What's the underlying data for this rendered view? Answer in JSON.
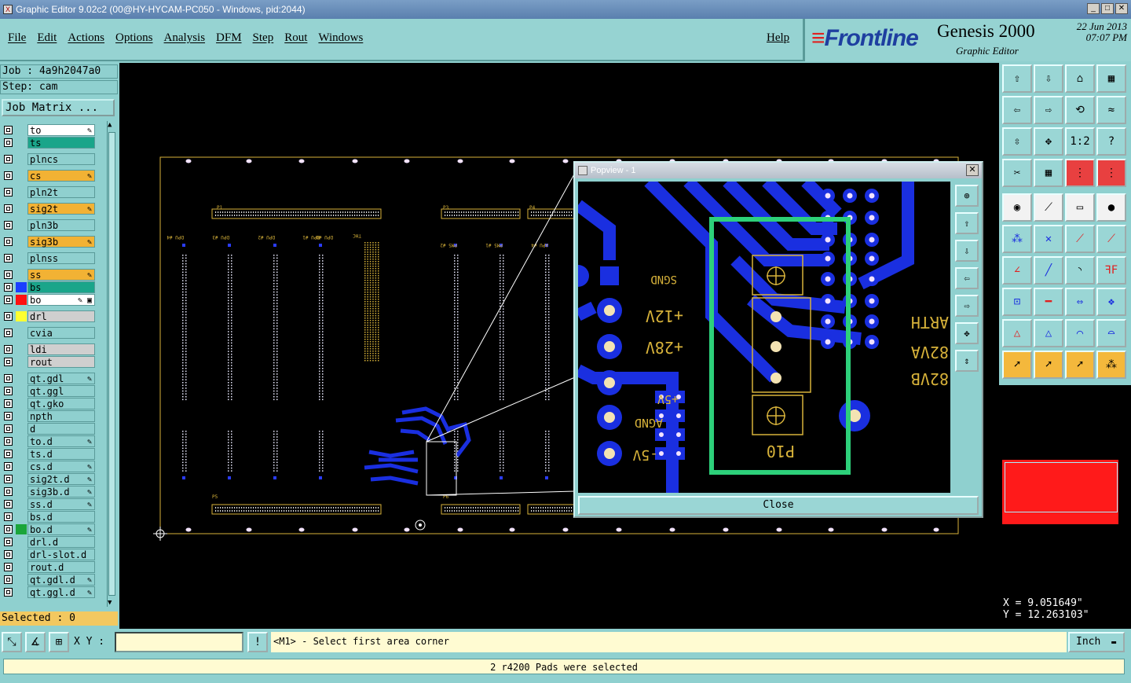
{
  "window": {
    "title": "Graphic Editor 9.02c2 (00@HY-HYCAM-PC050 - Windows, pid:2044)",
    "icon": "app-icon"
  },
  "menu": {
    "items": [
      "File",
      "Edit",
      "Actions",
      "Options",
      "Analysis",
      "DFM",
      "Step",
      "Rout",
      "Windows"
    ],
    "help": "Help"
  },
  "brand": {
    "logo": "Frontline",
    "product": "Genesis 2000",
    "subtitle": "Graphic Editor",
    "date": "22 Jun 2013",
    "time": "07:07 PM"
  },
  "left": {
    "job": "Job : 4a9h2047a0",
    "step": "Step: cam",
    "job_matrix": "Job Matrix ...",
    "layers": [
      {
        "name": "to",
        "color": "#ffffff",
        "swatch": "#8fd0cf",
        "mark": "✎"
      },
      {
        "name": "ts",
        "color": "#1aa58a",
        "swatch": "#8fd0cf",
        "mark": ""
      },
      {
        "name": "plncs",
        "color": "#8fd0cf",
        "swatch": "#8fd0cf",
        "mark": ""
      },
      {
        "name": "cs",
        "color": "#f2b234",
        "swatch": "#8fd0cf",
        "mark": "✎"
      },
      {
        "name": "pln2t",
        "color": "#8fd0cf",
        "swatch": "#8fd0cf",
        "mark": ""
      },
      {
        "name": "sig2t",
        "color": "#f2b234",
        "swatch": "#8fd0cf",
        "mark": "✎"
      },
      {
        "name": "pln3b",
        "color": "#8fd0cf",
        "swatch": "#8fd0cf",
        "mark": ""
      },
      {
        "name": "sig3b",
        "color": "#f2b234",
        "swatch": "#8fd0cf",
        "mark": "✎"
      },
      {
        "name": "plnss",
        "color": "#8fd0cf",
        "swatch": "#8fd0cf",
        "mark": ""
      },
      {
        "name": "ss",
        "color": "#f2b234",
        "swatch": "#8fd0cf",
        "mark": "✎"
      },
      {
        "name": "bs",
        "color": "#1aa58a",
        "swatch": "#1a3fff",
        "mark": ""
      },
      {
        "name": "bo",
        "color": "#ffffff",
        "swatch": "#ff1010",
        "mark": "✎ ▣"
      },
      {
        "name": "drl",
        "color": "#cfcfcf",
        "swatch": "#ffff30",
        "mark": ""
      },
      {
        "name": "cvia",
        "color": "#8fd0cf",
        "swatch": "#8fd0cf",
        "mark": ""
      },
      {
        "name": "ldi",
        "color": "#cfcfcf",
        "swatch": "#8fd0cf",
        "mark": ""
      },
      {
        "name": "rout",
        "color": "#cfcfcf",
        "swatch": "#8fd0cf",
        "mark": ""
      },
      {
        "name": "qt.gdl",
        "color": "#8fd0cf",
        "swatch": "#8fd0cf",
        "mark": "✎"
      },
      {
        "name": "qt.ggl",
        "color": "#8fd0cf",
        "swatch": "#8fd0cf",
        "mark": ""
      },
      {
        "name": "qt.gko",
        "color": "#8fd0cf",
        "swatch": "#8fd0cf",
        "mark": ""
      },
      {
        "name": "npth",
        "color": "#8fd0cf",
        "swatch": "#8fd0cf",
        "mark": ""
      },
      {
        "name": "d",
        "color": "#8fd0cf",
        "swatch": "#8fd0cf",
        "mark": ""
      },
      {
        "name": "to.d",
        "color": "#8fd0cf",
        "swatch": "#8fd0cf",
        "mark": "✎"
      },
      {
        "name": "ts.d",
        "color": "#8fd0cf",
        "swatch": "#8fd0cf",
        "mark": ""
      },
      {
        "name": "cs.d",
        "color": "#8fd0cf",
        "swatch": "#8fd0cf",
        "mark": "✎"
      },
      {
        "name": "sig2t.d",
        "color": "#8fd0cf",
        "swatch": "#8fd0cf",
        "mark": "✎"
      },
      {
        "name": "sig3b.d",
        "color": "#8fd0cf",
        "swatch": "#8fd0cf",
        "mark": "✎"
      },
      {
        "name": "ss.d",
        "color": "#8fd0cf",
        "swatch": "#8fd0cf",
        "mark": "✎"
      },
      {
        "name": "bs.d",
        "color": "#8fd0cf",
        "swatch": "#8fd0cf",
        "mark": ""
      },
      {
        "name": "bo.d",
        "color": "#8fd0cf",
        "swatch": "#1aa53a",
        "mark": "✎"
      },
      {
        "name": "drl.d",
        "color": "#8fd0cf",
        "swatch": "#8fd0cf",
        "mark": ""
      },
      {
        "name": "drl-slot.d",
        "color": "#8fd0cf",
        "swatch": "#8fd0cf",
        "mark": ""
      },
      {
        "name": "rout.d",
        "color": "#8fd0cf",
        "swatch": "#8fd0cf",
        "mark": ""
      },
      {
        "name": "qt.gdl.d",
        "color": "#8fd0cf",
        "swatch": "#8fd0cf",
        "mark": "✎"
      },
      {
        "name": "qt.ggl.d",
        "color": "#8fd0cf",
        "swatch": "#8fd0cf",
        "mark": "✎"
      }
    ],
    "selected": "Selected : 0"
  },
  "popview": {
    "title": "Popview - 1",
    "close": "Close",
    "labels": [
      "SGND",
      "+12V",
      "+28V",
      "+5V",
      "AGND",
      "-5V",
      "P10",
      "ARTH",
      "82VA",
      "82VB"
    ]
  },
  "coords": {
    "x": "X = 9.051649\"",
    "y": "Y = 12.263103\""
  },
  "bottom": {
    "xy_label": "X Y :",
    "xy_value": "",
    "prompt": "<M1> - Select first area corner",
    "units": "Inch",
    "status": "2 r4200 Pads were selected"
  },
  "board_labels": [
    "DPU #4",
    "DPU #3",
    "DPU #2",
    "DPU #1",
    "DPU #0",
    "THC",
    "PM5 #2",
    "PM5 #1",
    "APU #4",
    "P1",
    "P3",
    "P4",
    "P5",
    "P6"
  ],
  "colors": {
    "accent_cyan": "#8fd0cf",
    "trace_blue": "#1a2fe0",
    "silk_yellow": "#d7b23a",
    "select_green": "#2dd07a",
    "selected_red": "#ff1a1a"
  }
}
